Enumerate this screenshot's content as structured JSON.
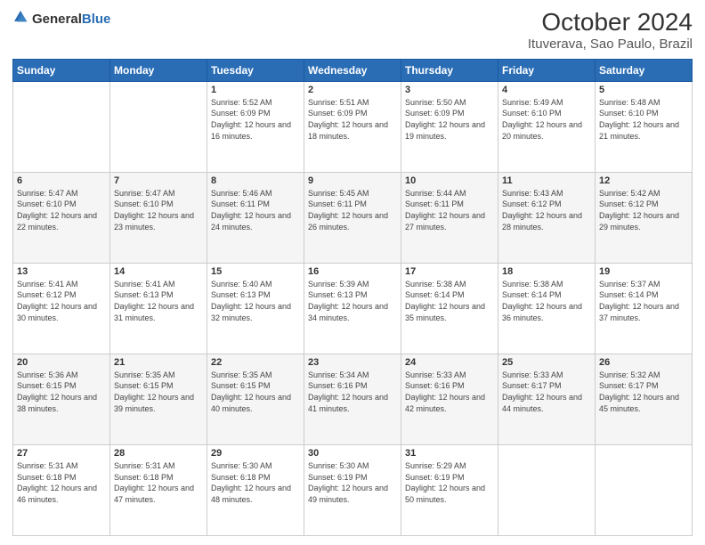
{
  "logo": {
    "general": "General",
    "blue": "Blue"
  },
  "title": "October 2024",
  "subtitle": "Ituverava, Sao Paulo, Brazil",
  "days_of_week": [
    "Sunday",
    "Monday",
    "Tuesday",
    "Wednesday",
    "Thursday",
    "Friday",
    "Saturday"
  ],
  "weeks": [
    [
      {
        "day": "",
        "sunrise": "",
        "sunset": "",
        "daylight": ""
      },
      {
        "day": "",
        "sunrise": "",
        "sunset": "",
        "daylight": ""
      },
      {
        "day": "1",
        "sunrise": "Sunrise: 5:52 AM",
        "sunset": "Sunset: 6:09 PM",
        "daylight": "Daylight: 12 hours and 16 minutes."
      },
      {
        "day": "2",
        "sunrise": "Sunrise: 5:51 AM",
        "sunset": "Sunset: 6:09 PM",
        "daylight": "Daylight: 12 hours and 18 minutes."
      },
      {
        "day": "3",
        "sunrise": "Sunrise: 5:50 AM",
        "sunset": "Sunset: 6:09 PM",
        "daylight": "Daylight: 12 hours and 19 minutes."
      },
      {
        "day": "4",
        "sunrise": "Sunrise: 5:49 AM",
        "sunset": "Sunset: 6:10 PM",
        "daylight": "Daylight: 12 hours and 20 minutes."
      },
      {
        "day": "5",
        "sunrise": "Sunrise: 5:48 AM",
        "sunset": "Sunset: 6:10 PM",
        "daylight": "Daylight: 12 hours and 21 minutes."
      }
    ],
    [
      {
        "day": "6",
        "sunrise": "Sunrise: 5:47 AM",
        "sunset": "Sunset: 6:10 PM",
        "daylight": "Daylight: 12 hours and 22 minutes."
      },
      {
        "day": "7",
        "sunrise": "Sunrise: 5:47 AM",
        "sunset": "Sunset: 6:10 PM",
        "daylight": "Daylight: 12 hours and 23 minutes."
      },
      {
        "day": "8",
        "sunrise": "Sunrise: 5:46 AM",
        "sunset": "Sunset: 6:11 PM",
        "daylight": "Daylight: 12 hours and 24 minutes."
      },
      {
        "day": "9",
        "sunrise": "Sunrise: 5:45 AM",
        "sunset": "Sunset: 6:11 PM",
        "daylight": "Daylight: 12 hours and 26 minutes."
      },
      {
        "day": "10",
        "sunrise": "Sunrise: 5:44 AM",
        "sunset": "Sunset: 6:11 PM",
        "daylight": "Daylight: 12 hours and 27 minutes."
      },
      {
        "day": "11",
        "sunrise": "Sunrise: 5:43 AM",
        "sunset": "Sunset: 6:12 PM",
        "daylight": "Daylight: 12 hours and 28 minutes."
      },
      {
        "day": "12",
        "sunrise": "Sunrise: 5:42 AM",
        "sunset": "Sunset: 6:12 PM",
        "daylight": "Daylight: 12 hours and 29 minutes."
      }
    ],
    [
      {
        "day": "13",
        "sunrise": "Sunrise: 5:41 AM",
        "sunset": "Sunset: 6:12 PM",
        "daylight": "Daylight: 12 hours and 30 minutes."
      },
      {
        "day": "14",
        "sunrise": "Sunrise: 5:41 AM",
        "sunset": "Sunset: 6:13 PM",
        "daylight": "Daylight: 12 hours and 31 minutes."
      },
      {
        "day": "15",
        "sunrise": "Sunrise: 5:40 AM",
        "sunset": "Sunset: 6:13 PM",
        "daylight": "Daylight: 12 hours and 32 minutes."
      },
      {
        "day": "16",
        "sunrise": "Sunrise: 5:39 AM",
        "sunset": "Sunset: 6:13 PM",
        "daylight": "Daylight: 12 hours and 34 minutes."
      },
      {
        "day": "17",
        "sunrise": "Sunrise: 5:38 AM",
        "sunset": "Sunset: 6:14 PM",
        "daylight": "Daylight: 12 hours and 35 minutes."
      },
      {
        "day": "18",
        "sunrise": "Sunrise: 5:38 AM",
        "sunset": "Sunset: 6:14 PM",
        "daylight": "Daylight: 12 hours and 36 minutes."
      },
      {
        "day": "19",
        "sunrise": "Sunrise: 5:37 AM",
        "sunset": "Sunset: 6:14 PM",
        "daylight": "Daylight: 12 hours and 37 minutes."
      }
    ],
    [
      {
        "day": "20",
        "sunrise": "Sunrise: 5:36 AM",
        "sunset": "Sunset: 6:15 PM",
        "daylight": "Daylight: 12 hours and 38 minutes."
      },
      {
        "day": "21",
        "sunrise": "Sunrise: 5:35 AM",
        "sunset": "Sunset: 6:15 PM",
        "daylight": "Daylight: 12 hours and 39 minutes."
      },
      {
        "day": "22",
        "sunrise": "Sunrise: 5:35 AM",
        "sunset": "Sunset: 6:15 PM",
        "daylight": "Daylight: 12 hours and 40 minutes."
      },
      {
        "day": "23",
        "sunrise": "Sunrise: 5:34 AM",
        "sunset": "Sunset: 6:16 PM",
        "daylight": "Daylight: 12 hours and 41 minutes."
      },
      {
        "day": "24",
        "sunrise": "Sunrise: 5:33 AM",
        "sunset": "Sunset: 6:16 PM",
        "daylight": "Daylight: 12 hours and 42 minutes."
      },
      {
        "day": "25",
        "sunrise": "Sunrise: 5:33 AM",
        "sunset": "Sunset: 6:17 PM",
        "daylight": "Daylight: 12 hours and 44 minutes."
      },
      {
        "day": "26",
        "sunrise": "Sunrise: 5:32 AM",
        "sunset": "Sunset: 6:17 PM",
        "daylight": "Daylight: 12 hours and 45 minutes."
      }
    ],
    [
      {
        "day": "27",
        "sunrise": "Sunrise: 5:31 AM",
        "sunset": "Sunset: 6:18 PM",
        "daylight": "Daylight: 12 hours and 46 minutes."
      },
      {
        "day": "28",
        "sunrise": "Sunrise: 5:31 AM",
        "sunset": "Sunset: 6:18 PM",
        "daylight": "Daylight: 12 hours and 47 minutes."
      },
      {
        "day": "29",
        "sunrise": "Sunrise: 5:30 AM",
        "sunset": "Sunset: 6:18 PM",
        "daylight": "Daylight: 12 hours and 48 minutes."
      },
      {
        "day": "30",
        "sunrise": "Sunrise: 5:30 AM",
        "sunset": "Sunset: 6:19 PM",
        "daylight": "Daylight: 12 hours and 49 minutes."
      },
      {
        "day": "31",
        "sunrise": "Sunrise: 5:29 AM",
        "sunset": "Sunset: 6:19 PM",
        "daylight": "Daylight: 12 hours and 50 minutes."
      },
      {
        "day": "",
        "sunrise": "",
        "sunset": "",
        "daylight": ""
      },
      {
        "day": "",
        "sunrise": "",
        "sunset": "",
        "daylight": ""
      }
    ]
  ]
}
